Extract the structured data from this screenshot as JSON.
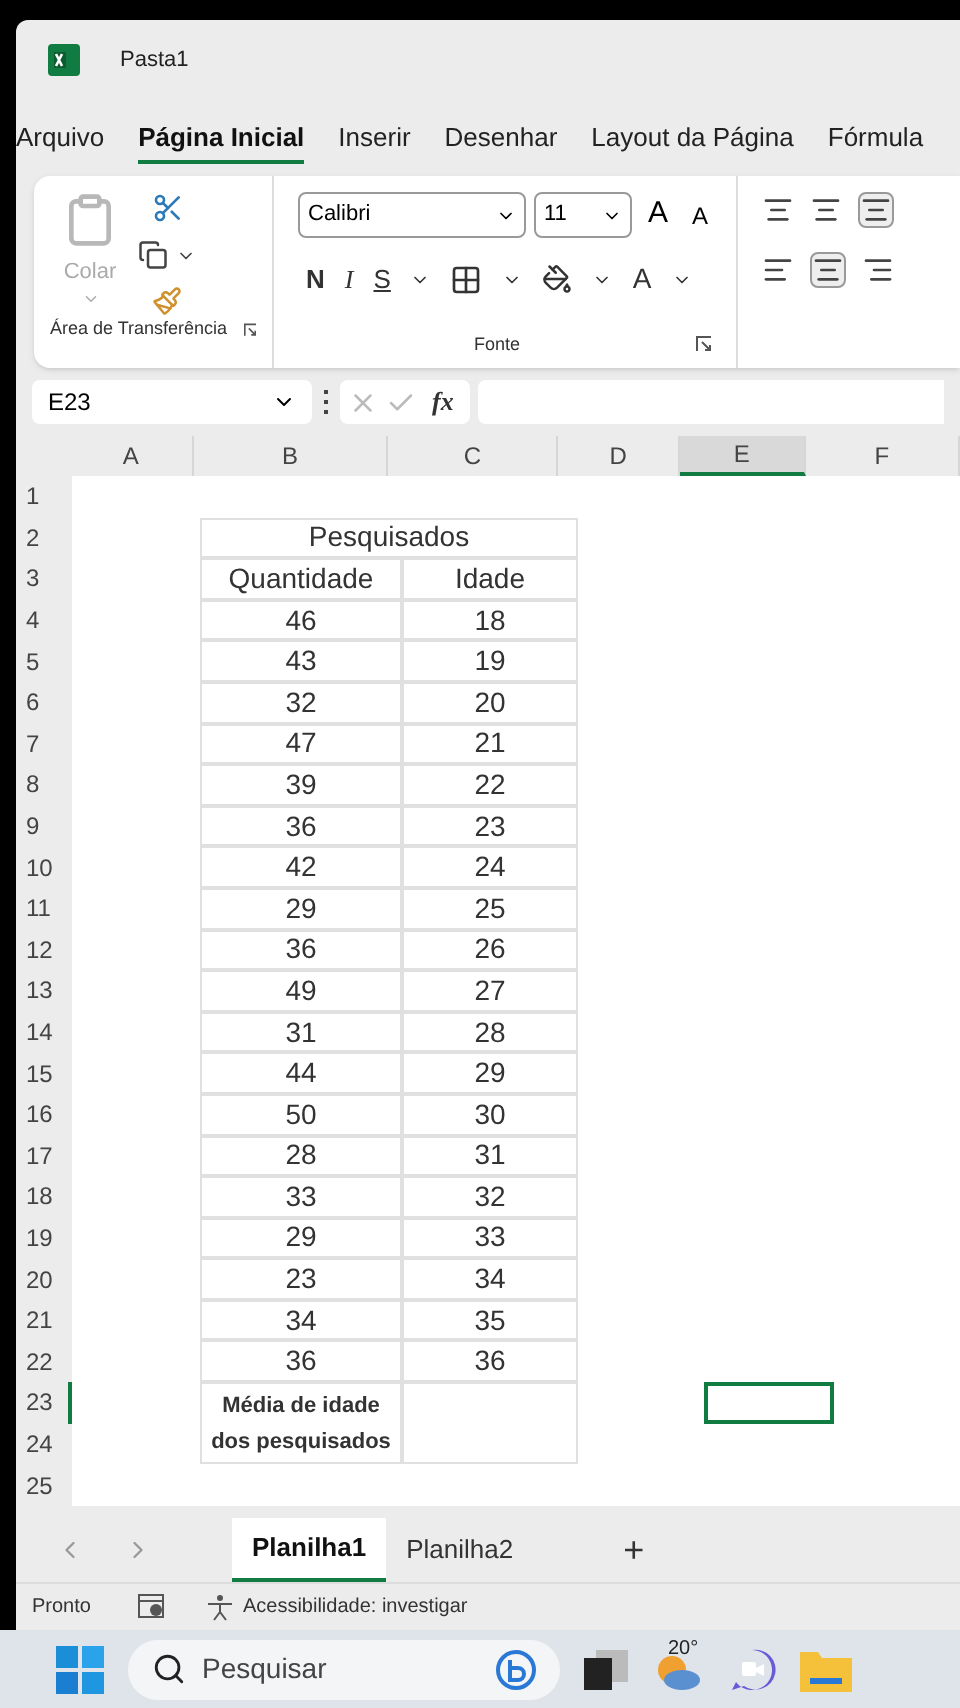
{
  "window": {
    "title": "Pasta1"
  },
  "menu_tabs": [
    {
      "label": "Arquivo",
      "selected": false
    },
    {
      "label": "Página Inicial",
      "selected": true
    },
    {
      "label": "Inserir",
      "selected": false
    },
    {
      "label": "Desenhar",
      "selected": false
    },
    {
      "label": "Layout da Página",
      "selected": false
    },
    {
      "label": "Fórmula",
      "selected": false
    }
  ],
  "ribbon": {
    "clipboard": {
      "paste_label": "Colar",
      "group_label": "Área de Transferência"
    },
    "font": {
      "font_name": "Calibri",
      "font_size": "11",
      "grow": "A",
      "shrink": "A",
      "bold": "N",
      "italic": "I",
      "underline": "S",
      "font_color": "A",
      "group_label": "Fonte"
    }
  },
  "formula_bar": {
    "name_box": "E23",
    "function_label": "fx"
  },
  "columns": [
    {
      "label": "A",
      "selected": false
    },
    {
      "label": "B",
      "selected": false
    },
    {
      "label": "C",
      "selected": false
    },
    {
      "label": "D",
      "selected": false
    },
    {
      "label": "E",
      "selected": true
    },
    {
      "label": "F",
      "selected": false
    }
  ],
  "rows": [
    {
      "label": "1",
      "selected": false
    },
    {
      "label": "2",
      "selected": false
    },
    {
      "label": "3",
      "selected": false
    },
    {
      "label": "4",
      "selected": false
    },
    {
      "label": "5",
      "selected": false
    },
    {
      "label": "6",
      "selected": false
    },
    {
      "label": "7",
      "selected": false
    },
    {
      "label": "8",
      "selected": false
    },
    {
      "label": "9",
      "selected": false
    },
    {
      "label": "10",
      "selected": false
    },
    {
      "label": "11",
      "selected": false
    },
    {
      "label": "12",
      "selected": false
    },
    {
      "label": "13",
      "selected": false
    },
    {
      "label": "14",
      "selected": false
    },
    {
      "label": "15",
      "selected": false
    },
    {
      "label": "16",
      "selected": false
    },
    {
      "label": "17",
      "selected": false
    },
    {
      "label": "18",
      "selected": false
    },
    {
      "label": "19",
      "selected": false
    },
    {
      "label": "20",
      "selected": false
    },
    {
      "label": "21",
      "selected": false
    },
    {
      "label": "22",
      "selected": false
    },
    {
      "label": "23",
      "selected": true
    },
    {
      "label": "24",
      "selected": false
    },
    {
      "label": "25",
      "selected": false
    }
  ],
  "table": {
    "title": "Pesquisados",
    "headers": [
      "Quantidade",
      "Idade"
    ],
    "rows": [
      [
        "46",
        "18"
      ],
      [
        "43",
        "19"
      ],
      [
        "32",
        "20"
      ],
      [
        "47",
        "21"
      ],
      [
        "39",
        "22"
      ],
      [
        "36",
        "23"
      ],
      [
        "42",
        "24"
      ],
      [
        "29",
        "25"
      ],
      [
        "36",
        "26"
      ],
      [
        "49",
        "27"
      ],
      [
        "31",
        "28"
      ],
      [
        "44",
        "29"
      ],
      [
        "50",
        "30"
      ],
      [
        "28",
        "31"
      ],
      [
        "33",
        "32"
      ],
      [
        "29",
        "33"
      ],
      [
        "23",
        "34"
      ],
      [
        "34",
        "35"
      ],
      [
        "36",
        "36"
      ]
    ],
    "footer": "Média de idade dos pesquisados"
  },
  "sheet_tabs": [
    {
      "label": "Planilha1",
      "selected": true
    },
    {
      "label": "Planilha2",
      "selected": false
    }
  ],
  "add_sheet": "+",
  "status_bar": {
    "mode": "Pronto",
    "accessibility": "Acessibilidade: investigar"
  },
  "taskbar": {
    "search_placeholder": "Pesquisar",
    "weather": "20°"
  }
}
